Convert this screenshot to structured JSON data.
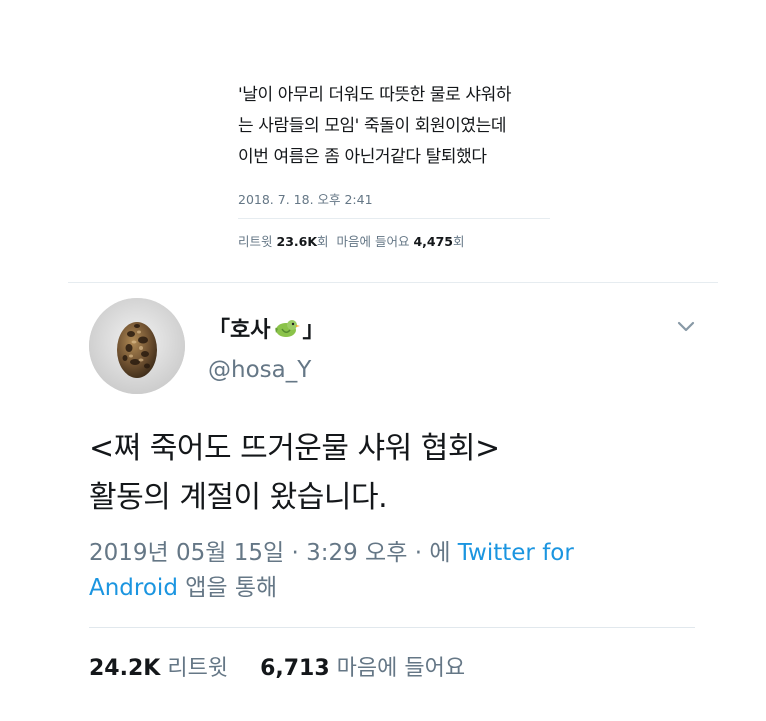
{
  "tweet1": {
    "text_lines": [
      "'날이 아무리 더워도 따뜻한 물로 샤워하",
      "는 사람들의 모임' 죽돌이 회원이였는데",
      "이번 여름은 좀 아닌거같다 탈퇴했다"
    ],
    "timestamp": "2018. 7. 18. 오후 2:41",
    "retweets_label": "리트윗",
    "retweets_count": "23.6K",
    "retweets_unit": "회",
    "likes_label": "마음에 들어요",
    "likes_count": "4,475",
    "likes_unit": "회"
  },
  "tweet2": {
    "display_name_open": "「호사",
    "display_name_close": "」",
    "name_emoji_icon": "bird-emoji-icon",
    "handle": "@hosa_Y",
    "more_icon": "chevron-down-icon",
    "text_lines": [
      "<쪄 죽어도 뜨거운물 샤워 협회>",
      "활동의 계절이 왔습니다."
    ],
    "meta_prefix": "2019년 05월 15일 · 3:29 오후 · 에 ",
    "meta_source": "Twitter for Android",
    "meta_suffix": " 앱을 통해",
    "retweets_count": "24.2K",
    "retweets_label": "리트윗",
    "likes_count": "6,713",
    "likes_label": "마음에 들어요"
  },
  "colors": {
    "text_primary": "#14171a",
    "text_secondary": "#657786",
    "link": "#1b95e0",
    "divider": "#e6ecf0"
  }
}
